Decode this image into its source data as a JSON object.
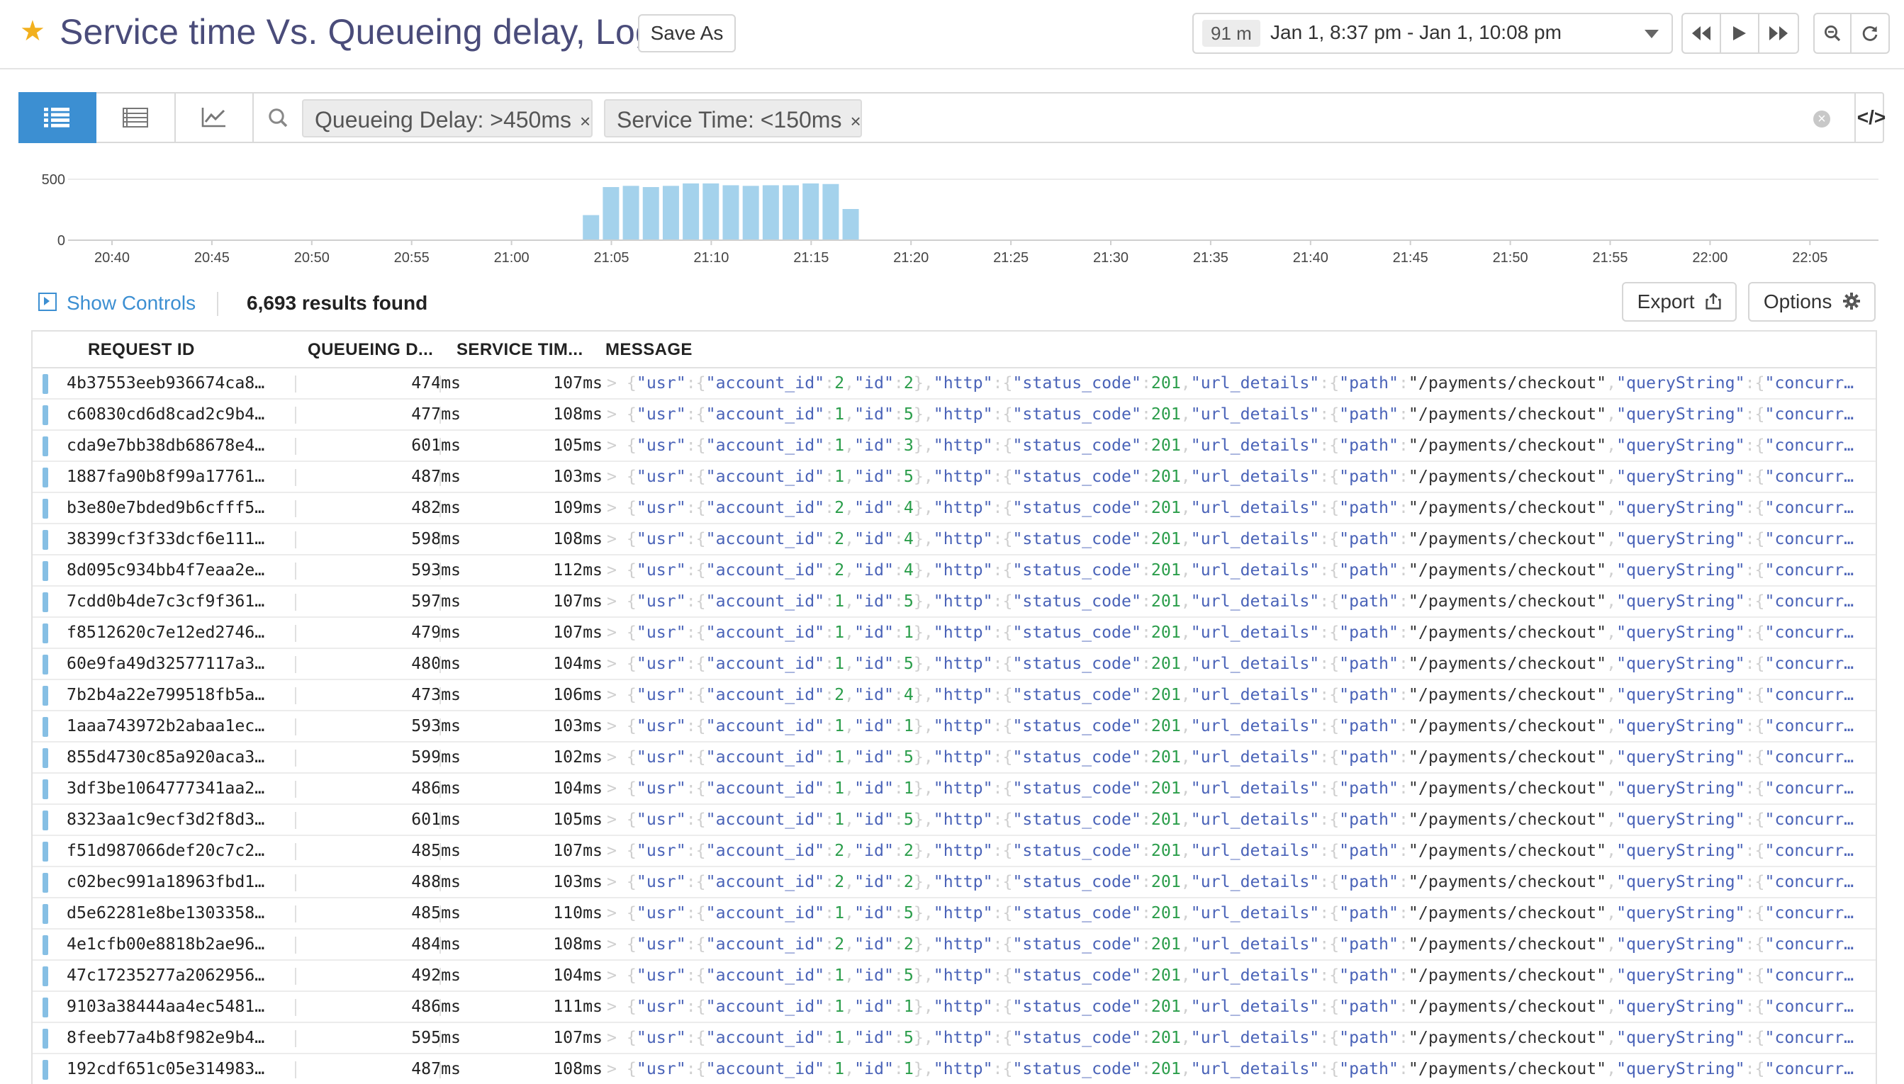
{
  "header": {
    "title": "Service time Vs. Queueing delay, Logs",
    "save_as_label": "Save As",
    "time_span": "91 m",
    "time_range": "Jan 1, 8:37 pm - Jan 1, 10:08 pm"
  },
  "search": {
    "filters": [
      {
        "label": "Queueing Delay: >450ms",
        "remove": "×"
      },
      {
        "label": "Service Time: <150ms",
        "remove": "×"
      }
    ],
    "clear": "×",
    "code_toggle": "</>"
  },
  "chart_data": {
    "type": "bar",
    "categories": [
      "21:04",
      "21:05",
      "21:06",
      "21:07",
      "21:08",
      "21:09",
      "21:10",
      "21:11",
      "21:12",
      "21:13",
      "21:14",
      "21:15",
      "21:16",
      "21:17"
    ],
    "values": [
      200,
      430,
      440,
      430,
      440,
      460,
      460,
      445,
      440,
      445,
      445,
      460,
      455,
      250
    ],
    "x_ticks": [
      "20:40",
      "20:45",
      "20:50",
      "20:55",
      "21:00",
      "21:05",
      "21:10",
      "21:15",
      "21:20",
      "21:25",
      "21:30",
      "21:35",
      "21:40",
      "21:45",
      "21:50",
      "21:55",
      "22:00",
      "22:05"
    ],
    "y_ticks": [
      "500",
      "0"
    ],
    "ylim": [
      0,
      500
    ],
    "color": "#a4d2ec",
    "grid": true
  },
  "controls": {
    "show_controls_label": "Show Controls",
    "results_label": "6,693 results found",
    "export_label": "Export",
    "options_label": "Options"
  },
  "table": {
    "columns": [
      "REQUEST ID",
      "QUEUEING D...",
      "SERVICE TIM...",
      "MESSAGE"
    ],
    "rows": [
      {
        "id": "4b37553eeb936674ca8…",
        "qd": "474ms",
        "st": "107ms",
        "acc": "2",
        "uid": "2"
      },
      {
        "id": "c60830cd6d8cad2c9b4…",
        "qd": "477ms",
        "st": "108ms",
        "acc": "1",
        "uid": "5"
      },
      {
        "id": "cda9e7bb38db68678e4…",
        "qd": "601ms",
        "st": "105ms",
        "acc": "1",
        "uid": "3"
      },
      {
        "id": "1887fa90b8f99a17761…",
        "qd": "487ms",
        "st": "103ms",
        "acc": "1",
        "uid": "5"
      },
      {
        "id": "b3e80e7bded9b6cfff5…",
        "qd": "482ms",
        "st": "109ms",
        "acc": "2",
        "uid": "4"
      },
      {
        "id": "38399cf3f33dcf6e111…",
        "qd": "598ms",
        "st": "108ms",
        "acc": "2",
        "uid": "4"
      },
      {
        "id": "8d095c934bb4f7eaa2e…",
        "qd": "593ms",
        "st": "112ms",
        "acc": "2",
        "uid": "4"
      },
      {
        "id": "7cdd0b4de7c3cf9f361…",
        "qd": "597ms",
        "st": "107ms",
        "acc": "1",
        "uid": "5"
      },
      {
        "id": "f8512620c7e12ed2746…",
        "qd": "479ms",
        "st": "107ms",
        "acc": "1",
        "uid": "1"
      },
      {
        "id": "60e9fa49d32577117a3…",
        "qd": "480ms",
        "st": "104ms",
        "acc": "1",
        "uid": "5"
      },
      {
        "id": "7b2b4a22e799518fb5a…",
        "qd": "473ms",
        "st": "106ms",
        "acc": "2",
        "uid": "4"
      },
      {
        "id": "1aaa743972b2abaa1ec…",
        "qd": "593ms",
        "st": "103ms",
        "acc": "1",
        "uid": "1"
      },
      {
        "id": "855d4730c85a920aca3…",
        "qd": "599ms",
        "st": "102ms",
        "acc": "1",
        "uid": "5"
      },
      {
        "id": "3df3be1064777341aa2…",
        "qd": "486ms",
        "st": "104ms",
        "acc": "1",
        "uid": "1"
      },
      {
        "id": "8323aa1c9ecf3d2f8d3…",
        "qd": "601ms",
        "st": "105ms",
        "acc": "1",
        "uid": "5"
      },
      {
        "id": "f51d987066def20c7c2…",
        "qd": "485ms",
        "st": "107ms",
        "acc": "2",
        "uid": "2"
      },
      {
        "id": "c02bec991a18963fbd1…",
        "qd": "488ms",
        "st": "103ms",
        "acc": "2",
        "uid": "2"
      },
      {
        "id": "d5e62281e8be1303358…",
        "qd": "485ms",
        "st": "110ms",
        "acc": "1",
        "uid": "5"
      },
      {
        "id": "4e1cfb00e8818b2ae96…",
        "qd": "484ms",
        "st": "108ms",
        "acc": "2",
        "uid": "2"
      },
      {
        "id": "47c17235277a2062956…",
        "qd": "492ms",
        "st": "104ms",
        "acc": "1",
        "uid": "5"
      },
      {
        "id": "9103a38444aa4ec5481…",
        "qd": "486ms",
        "st": "111ms",
        "acc": "1",
        "uid": "1"
      },
      {
        "id": "8feeb77a4b8f982e9b4…",
        "qd": "595ms",
        "st": "107ms",
        "acc": "1",
        "uid": "5"
      },
      {
        "id": "192cdf651c05e314983…",
        "qd": "487ms",
        "st": "108ms",
        "acc": "1",
        "uid": "1"
      }
    ],
    "message": {
      "prefix": "> ",
      "k_usr": "\"usr\"",
      "k_account": "\"account_id\"",
      "k_id": "\"id\"",
      "k_http": "\"http\"",
      "k_status": "\"status_code\"",
      "status_value": "201",
      "k_url": "\"url_details\"",
      "k_path": "\"path\"",
      "path_value": "\"/payments/checkout\"",
      "k_query": "\"queryString\"",
      "k_concurr": "\"concurr…"
    }
  },
  "colors": {
    "accent": "#3c8fd2",
    "title": "#4a4c7a",
    "star": "#f2b01e",
    "histogram": "#a4d2ec",
    "row_marker": "#86bfe4",
    "json_key": "#4a63b8",
    "json_number": "#2a9d4a"
  },
  "icons": [
    "star-icon",
    "rewind-icon",
    "play-icon",
    "fast-forward-icon",
    "zoom-out-icon",
    "refresh-icon",
    "list-view-icon",
    "table-view-icon",
    "timeseries-view-icon",
    "search-icon",
    "clear-search-icon",
    "code-icon",
    "show-controls-icon",
    "export-icon",
    "gear-icon"
  ]
}
